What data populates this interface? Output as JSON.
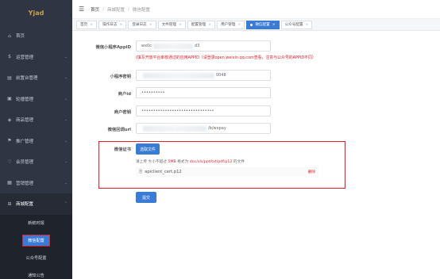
{
  "logo": {
    "text": "Yjad"
  },
  "sidebar": {
    "items": [
      {
        "icon": "⌂",
        "label": "首页",
        "open": false,
        "chevron": ""
      },
      {
        "icon": "$",
        "label": "运营管理",
        "chevron": "⌄"
      },
      {
        "icon": "▤",
        "label": "前置台管理",
        "chevron": "⌄"
      },
      {
        "icon": "▣",
        "label": "轮播管理",
        "chevron": "⌄"
      },
      {
        "icon": "◈",
        "label": "商品管理",
        "chevron": "⌄"
      },
      {
        "icon": "⚑",
        "label": "推广管理",
        "chevron": "⌄"
      },
      {
        "icon": "♡",
        "label": "会员管理",
        "chevron": "⌄"
      },
      {
        "icon": "▦",
        "label": "营销管理",
        "chevron": "⌄"
      },
      {
        "icon": "⊞",
        "label": "商城配置",
        "chevron": "⌃"
      }
    ],
    "sub": [
      "新鲜时报",
      "微信配置",
      "公众号配置",
      "通知公告"
    ]
  },
  "header": {
    "breadcrumb": [
      "首页",
      "商城配置",
      "微信配置"
    ]
  },
  "tabs": [
    {
      "label": "首页"
    },
    {
      "label": "操作日志"
    },
    {
      "label": "登录日志"
    },
    {
      "label": "文件管理"
    },
    {
      "label": "配置管理"
    },
    {
      "label": "用户管理"
    },
    {
      "label": "微信配置",
      "active": true
    },
    {
      "label": "公众号配置"
    }
  ],
  "form": {
    "appid_label": "微信小程序AppID",
    "appid_value_start": "wx0c",
    "appid_value_end": "d3",
    "appid_hint": "(填写开放平台审核通过的应用APPID（请登录open.weixin.qq.com查看，注意与公众号的APPID不同）",
    "secret_label": "小程序密钥",
    "secret_value_end": "0048",
    "mchid_label": "商户id",
    "mchid_value": "••••••••••",
    "mchkey_label": "商户密钥",
    "mchkey_value": "•••••••••••••••••••••••••••••••",
    "notify_label": "微信回调url",
    "notify_value_end": "/b/wxpay",
    "cert_label": "微信证书",
    "choose_btn": "选取文件",
    "upload_hint_a": "请上传 大小不超过 ",
    "upload_hint_size": "5MB",
    "upload_hint_b": " 格式为 ",
    "upload_hint_fmt": "doc/xls/ppt/txt/pdf/p12",
    "upload_hint_c": " 的文件",
    "file_name": "apiclient_cert.p12",
    "delete_label": "删除",
    "submit_label": "提交"
  }
}
